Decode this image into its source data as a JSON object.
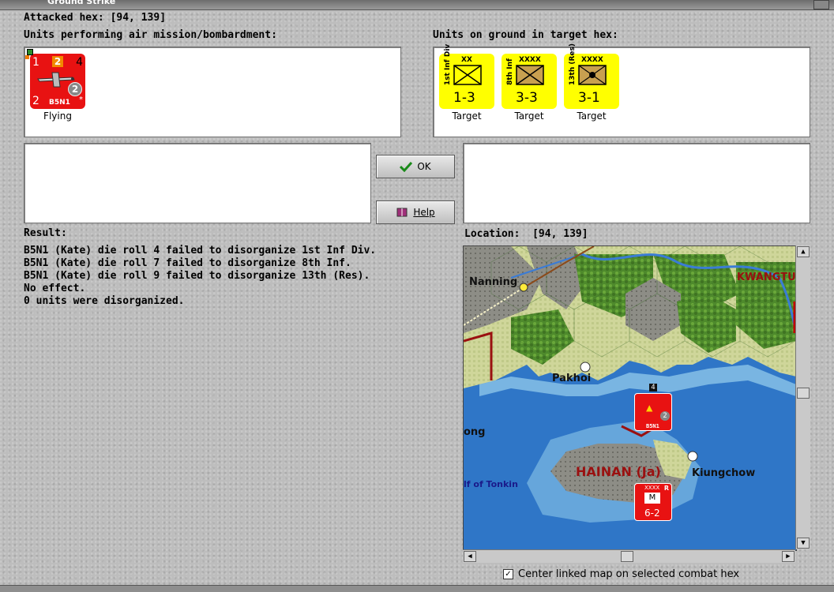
{
  "window": {
    "title": "Ground Strike"
  },
  "attacked_hex": {
    "label": "Attacked hex:",
    "value": "[94, 139]"
  },
  "air_units": {
    "label": "Units performing air mission/bombardment:",
    "units": [
      {
        "name": "B5N1",
        "top_left": "1",
        "top_mid": "2",
        "top_right": "4",
        "bottom_left": "2",
        "badge": "2",
        "star": "*",
        "caption": "Flying"
      }
    ]
  },
  "ground_units": {
    "label": "Units on ground in target hex:",
    "units": [
      {
        "side_name": "1st Inf Div",
        "size": "XX",
        "strength": "1-3",
        "caption": "Target"
      },
      {
        "side_name": "8th Inf",
        "size": "XXXX",
        "strength": "3-3",
        "caption": "Target"
      },
      {
        "side_name": "13th (Res)",
        "size": "XXXX",
        "strength": "3-1",
        "caption": "Target"
      }
    ]
  },
  "buttons": {
    "ok": "OK",
    "help": "Help"
  },
  "result": {
    "label": "Result:",
    "lines": [
      "B5N1 (Kate) die roll 4 failed to disorganize 1st Inf Div.",
      "B5N1 (Kate) die roll 7 failed to disorganize 8th Inf.",
      "B5N1 (Kate) die roll 9 failed to disorganize 13th (Res).",
      "No effect.",
      "0 units were disorganized."
    ]
  },
  "location": {
    "label": "Location:",
    "value": "[94, 139]"
  },
  "map": {
    "labels": {
      "nanning": "Nanning",
      "kwangtung": "KWANGTU",
      "pakhoi": "Pakhoi",
      "ong": "ong",
      "hainan": "HAINAN (Ja)",
      "kiungchow": "Kiungchow",
      "gulf": "lf of Tonkin"
    },
    "air_counter": {
      "name": "B5N1",
      "badge": "2",
      "stack": "4"
    },
    "ground_counter": {
      "size": "XXXX",
      "corner": "R",
      "type": "M",
      "strength": "6-2"
    },
    "colors": {
      "sea": "#2f76c7",
      "coast": "#8cc6e8",
      "red_unit": "#e81212"
    }
  },
  "center_option": {
    "label": "Center linked map on selected combat hex",
    "checked": true
  }
}
